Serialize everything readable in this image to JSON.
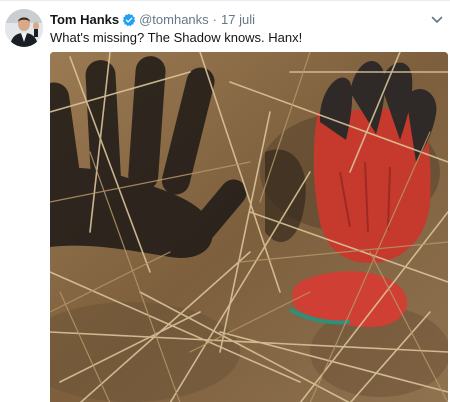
{
  "tweet": {
    "display_name": "Tom Hanks",
    "verified": true,
    "handle": "@tomhanks",
    "separator": "·",
    "timestamp": "17 juli",
    "text": "What's missing? The Shadow knows. Hanx!",
    "menu_icon": "chevron-down-icon",
    "avatar_icon": "profile-photo",
    "media": {
      "description_icon": "photo-glove-shadow"
    }
  },
  "colors": {
    "verified_blue": "#1da1f2",
    "handle_gray": "#657786",
    "text_dark": "#14171a",
    "glove_red": "#c63a2e"
  }
}
